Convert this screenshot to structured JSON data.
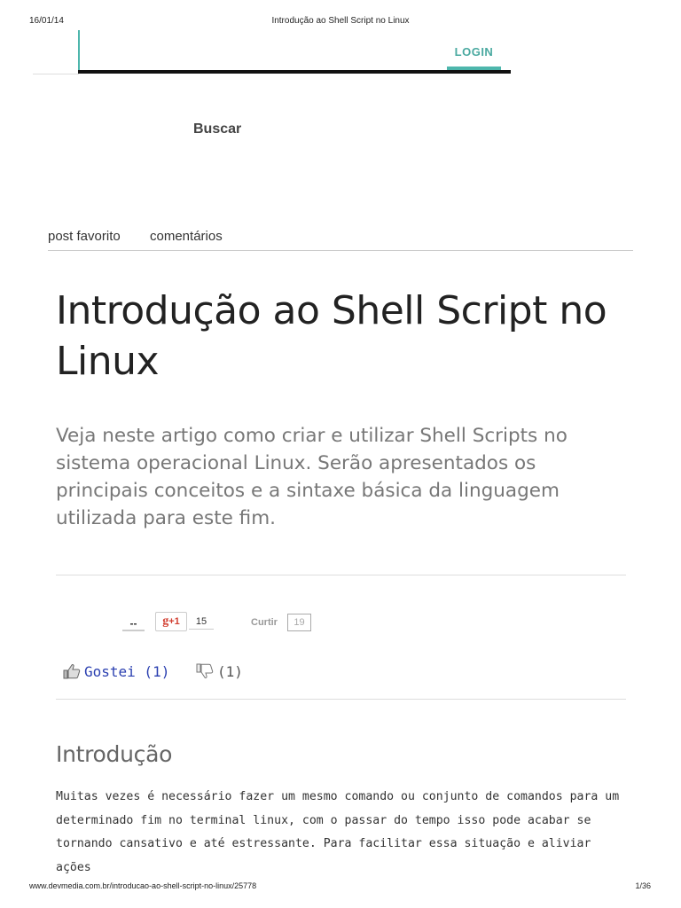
{
  "print_header": {
    "date": "16/01/14",
    "title": "Introdução ao Shell Script no Linux"
  },
  "print_footer": {
    "url": "www.devmedia.com.br/introducao-ao-shell-script-no-linux/25778",
    "page": "1/36"
  },
  "nav": {
    "login_label": "LOGIN",
    "search_label": "Buscar",
    "accent_color": "#4db6ac"
  },
  "post_actions": {
    "favorite_label": "post favorito",
    "comments_label": "comentários"
  },
  "article": {
    "title": "Introdução ao Shell Script no Linux",
    "subtitle": "Veja neste artigo como criar e utilizar Shell Scripts no sistema operacional Linux. Serão apresentados os principais conceitos e a sintaxe básica da linguagem utilizada para este fim.",
    "section_heading": "Introdução",
    "body": "Muitas vezes é necessário fazer um mesmo comando ou conjunto de comandos para um determinado fim no terminal linux, com o passar do tempo isso pode acabar se tornando cansativo e até estressante. Para facilitar essa situação e aliviar ações"
  },
  "social": {
    "unknown_count": "--",
    "gplus_label": "+1",
    "gplus_count": "15",
    "facebook_label": "Curtir",
    "facebook_count": "19"
  },
  "rating": {
    "like_label": "Gostei (1)",
    "dislike_label": "(1)",
    "like_icon": "thumbs-up-icon",
    "dislike_icon": "thumbs-down-icon"
  }
}
